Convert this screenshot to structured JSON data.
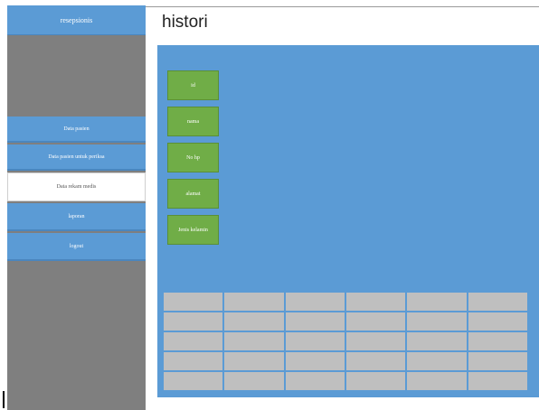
{
  "sidebar": {
    "title": "resepsionis",
    "menu": [
      {
        "label": "Data pasien",
        "active": false
      },
      {
        "label": "Data pasien untuk periksa",
        "active": false
      },
      {
        "label": "Data rekam medis",
        "active": true
      },
      {
        "label": "laporan",
        "active": false
      },
      {
        "label": "logout",
        "active": false
      }
    ]
  },
  "main": {
    "title": "histori",
    "fields": [
      "id",
      "nama",
      "No hp",
      "alamat",
      "Jenis kelamin"
    ],
    "table": {
      "rows": 5,
      "cols": 6
    }
  },
  "colors": {
    "accent": "#5b9bd5",
    "sidebar_bg": "#7f7f7f",
    "field_green": "#70ad47",
    "cell_gray": "#bfbfbf"
  }
}
